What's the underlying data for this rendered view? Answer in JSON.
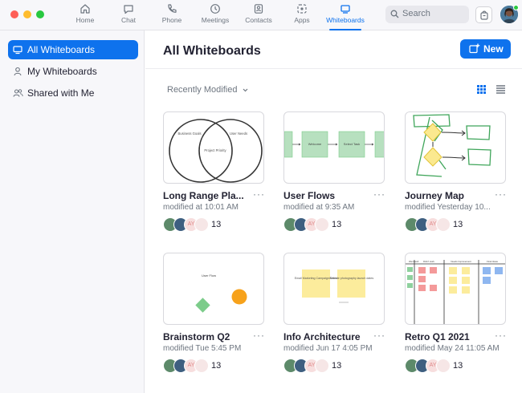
{
  "nav": {
    "tabs": [
      {
        "label": "Home",
        "icon": "home-icon"
      },
      {
        "label": "Chat",
        "icon": "chat-icon"
      },
      {
        "label": "Phone",
        "icon": "phone-icon"
      },
      {
        "label": "Meetings",
        "icon": "clock-icon"
      },
      {
        "label": "Contacts",
        "icon": "contacts-icon"
      },
      {
        "label": "Apps",
        "icon": "apps-icon"
      },
      {
        "label": "Whiteboards",
        "icon": "whiteboard-icon",
        "active": true
      }
    ],
    "search_placeholder": "Search"
  },
  "sidebar": {
    "items": [
      {
        "label": "All Whiteboards",
        "active": true
      },
      {
        "label": "My Whiteboards"
      },
      {
        "label": "Shared with Me"
      }
    ]
  },
  "main": {
    "title": "All Whiteboards",
    "new_label": "New",
    "sort_label": "Recently Modified",
    "cards": [
      {
        "title": "Long Range Pla...",
        "modified": "modified at 10:01 AM",
        "initials": "AY",
        "count": "13",
        "thumb": {
          "venn_left": "Business Goals",
          "venn_right": "User Needs",
          "venn_center": "Project Priority"
        }
      },
      {
        "title": "User Flows",
        "modified": "modified at 9:35 AM",
        "initials": "AY",
        "count": "13",
        "thumb": {
          "box1": "Welcome",
          "box2": "Select Task"
        }
      },
      {
        "title": "Journey Map",
        "modified": "modified Yesterday 10...",
        "initials": "AY",
        "count": "13"
      },
      {
        "title": "Brainstorm Q2",
        "modified": "modified Tue 5:45 PM",
        "initials": "AY",
        "count": "13",
        "thumb": {
          "label": "User Flow"
        }
      },
      {
        "title": "Info Architecture",
        "modified": "modified Jun 17 4:05 PM",
        "initials": "AY",
        "count": "13",
        "thumb": {
          "note1": "Email Marketing Campaign Dates",
          "note2": "Website photography launch dates"
        }
      },
      {
        "title": "Retro Q1 2021",
        "modified": "modified May 24 11:05 AM",
        "initials": "AY",
        "count": "13",
        "thumb": {
          "col1": "Went well",
          "col2": "Didn't work",
          "col3": "Needs Improvement",
          "col4": "Final Ideas"
        }
      }
    ]
  },
  "colors": {
    "accent": "#0e72ed",
    "sticky_yellow": "#fcec9c",
    "shape_green": "#7ccc8a",
    "shape_orange": "#f7a21b"
  }
}
